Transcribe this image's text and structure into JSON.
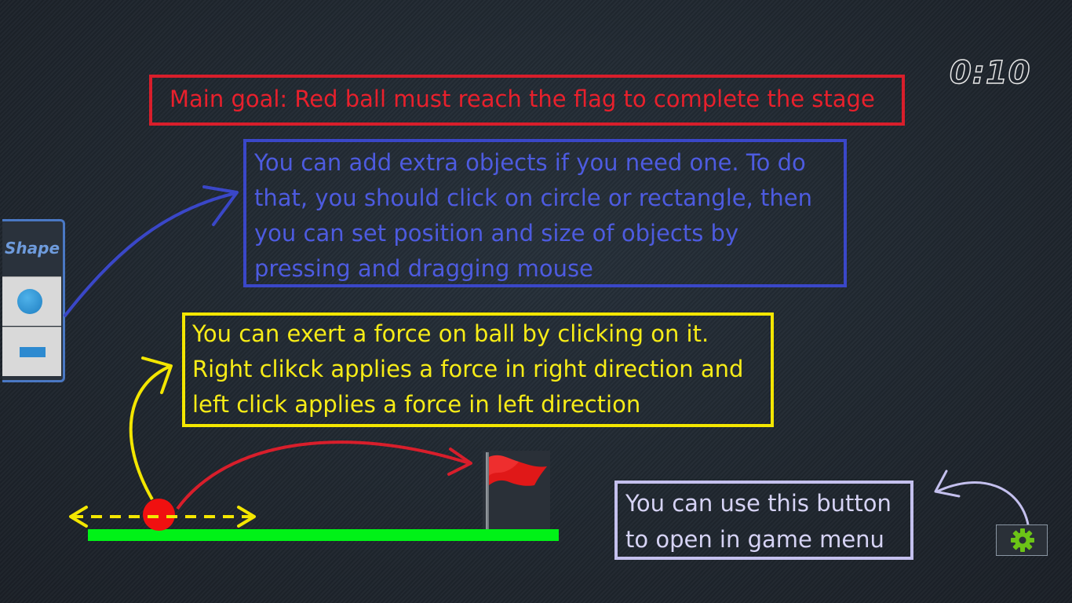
{
  "hud": {
    "timer": "0:10"
  },
  "tutorial": {
    "goal": "Main goal: Red ball must reach the flag to complete the stage",
    "objects": "You can add extra objects if you need one. To do that, you should click on circle or rectangle, then you can set position and size of objects by pressing and dragging mouse",
    "force": "You can exert a force on ball by clicking on it. Right clikck applies a force in right direction and left click applies a force in left direction",
    "menu": "You can use this button to open in game menu"
  },
  "shape_panel": {
    "title": "Shape",
    "tools": [
      {
        "icon": "circle-icon"
      },
      {
        "icon": "rectangle-icon"
      }
    ]
  },
  "colors": {
    "goal": "#d81e2b",
    "objects": "#3a47c8",
    "force": "#f3e600",
    "menu": "#c4c0ee",
    "ground": "#00f217",
    "ball": "#f01010",
    "flag": "#e01818",
    "gear": "#6cc417"
  },
  "settings_button": {
    "icon": "gear-icon"
  }
}
